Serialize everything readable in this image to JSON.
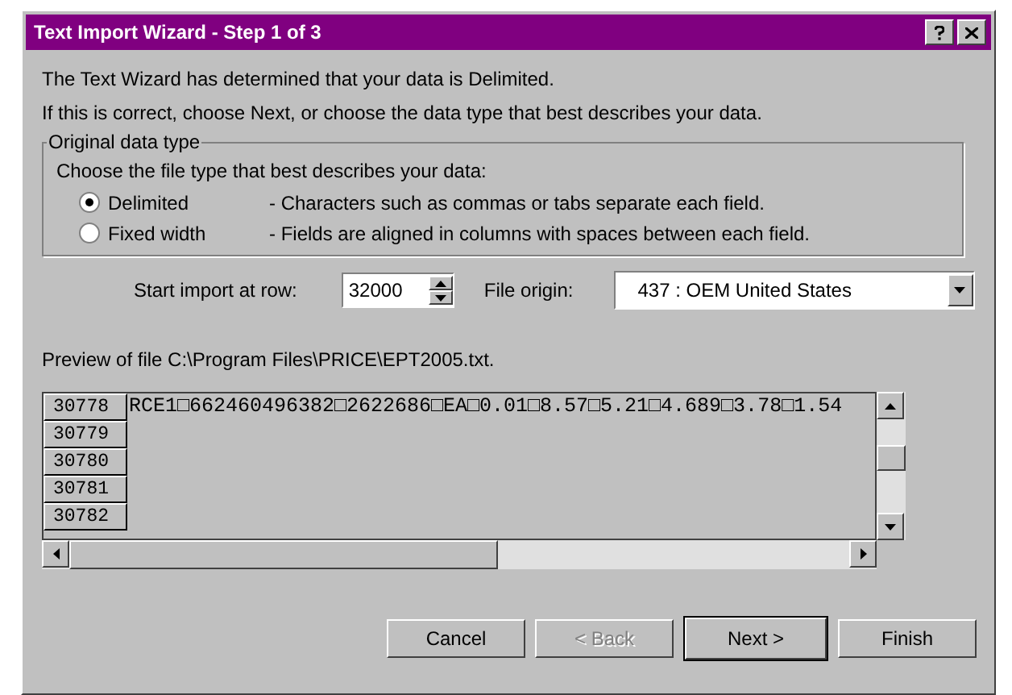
{
  "window": {
    "title": "Text Import Wizard - Step 1 of 3"
  },
  "intro": [
    "The Text Wizard has determined that your data is Delimited.",
    "If this is correct, choose Next, or choose the data type that best describes your data."
  ],
  "group": {
    "legend": "Original data type",
    "prompt": "Choose the file type that best describes your data:",
    "options": [
      {
        "label": "Delimited",
        "description": "- Characters such as commas or tabs separate each field.",
        "selected": true
      },
      {
        "label": "Fixed width",
        "description": "- Fields are aligned in columns with spaces between each field.",
        "selected": false
      }
    ]
  },
  "start_row": {
    "label": "Start import at row:",
    "value": "32000"
  },
  "file_origin": {
    "label": "File origin:",
    "value": "437 : OEM United States"
  },
  "preview": {
    "label": "Preview of file C:\\Program Files\\PRICE\\EPT2005.txt.",
    "rows": [
      {
        "number": "30778",
        "text": "RCE1□662460496382□2622686□EA□0.01□8.57□5.21□4.689□3.78□1.54"
      },
      {
        "number": "30779",
        "text": ""
      },
      {
        "number": "30780",
        "text": ""
      },
      {
        "number": "30781",
        "text": ""
      },
      {
        "number": "30782",
        "text": ""
      }
    ]
  },
  "buttons": [
    {
      "label": "Cancel",
      "disabled": false,
      "default": false
    },
    {
      "label": "< Back",
      "disabled": true,
      "default": false
    },
    {
      "label": "Next >",
      "disabled": false,
      "default": true
    },
    {
      "label": "Finish",
      "disabled": false,
      "default": false
    }
  ]
}
